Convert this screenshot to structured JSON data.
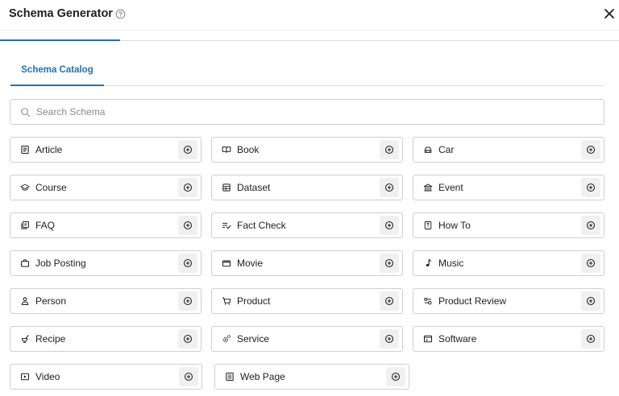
{
  "header": {
    "title": "Schema Generator",
    "help_icon": "help-circle-icon",
    "close_icon": "close-icon"
  },
  "progress": {
    "value": 0.194,
    "color": "#2271b1"
  },
  "tabs": [
    {
      "label": "Schema Catalog",
      "active": true
    }
  ],
  "search": {
    "placeholder": "Search Schema",
    "value": ""
  },
  "accent_color": "#2271b1",
  "schemas": [
    {
      "label": "Article",
      "icon": "article-icon"
    },
    {
      "label": "Book",
      "icon": "book-icon"
    },
    {
      "label": "Car",
      "icon": "car-icon"
    },
    {
      "label": "Course",
      "icon": "graduation-cap-icon"
    },
    {
      "label": "Dataset",
      "icon": "dataset-icon"
    },
    {
      "label": "Event",
      "icon": "event-venue-icon"
    },
    {
      "label": "FAQ",
      "icon": "faq-icon"
    },
    {
      "label": "Fact Check",
      "icon": "fact-check-icon"
    },
    {
      "label": "How To",
      "icon": "how-to-icon"
    },
    {
      "label": "Job Posting",
      "icon": "briefcase-icon"
    },
    {
      "label": "Movie",
      "icon": "movie-icon"
    },
    {
      "label": "Music",
      "icon": "music-note-icon"
    },
    {
      "label": "Person",
      "icon": "person-icon"
    },
    {
      "label": "Product",
      "icon": "cart-icon"
    },
    {
      "label": "Product Review",
      "icon": "review-icon"
    },
    {
      "label": "Recipe",
      "icon": "recipe-icon"
    },
    {
      "label": "Service",
      "icon": "service-icon"
    },
    {
      "label": "Software",
      "icon": "software-icon"
    },
    {
      "label": "Video",
      "icon": "video-icon"
    },
    {
      "label": "Web Page",
      "icon": "web-page-icon"
    }
  ]
}
